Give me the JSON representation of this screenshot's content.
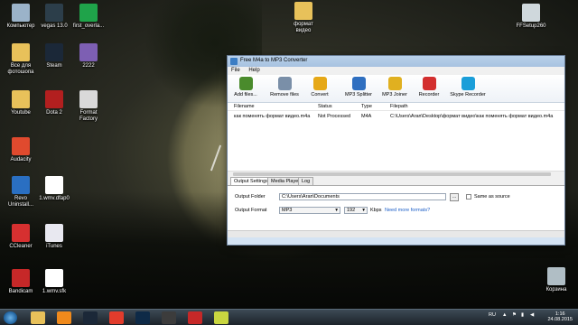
{
  "desktop": {
    "icons": [
      {
        "label": "Компьютер",
        "icon": "computer-icon",
        "color": "#9bb3c9"
      },
      {
        "label": "vegas 13.0",
        "icon": "vegas-icon",
        "color": "#2c3e4a"
      },
      {
        "label": "first_overla...",
        "icon": "green-app-icon",
        "color": "#1fa34a"
      },
      {
        "label": "Все для фотошопа",
        "icon": "folder-icon",
        "color": "#e8c15a"
      },
      {
        "label": "Steam",
        "icon": "steam-icon",
        "color": "#1b2838"
      },
      {
        "label": "2222",
        "icon": "image-file-icon",
        "color": "#7d5fb3"
      },
      {
        "label": "Youtube",
        "icon": "folder-icon",
        "color": "#e8c15a"
      },
      {
        "label": "Dota 2",
        "icon": "dota-icon",
        "color": "#b21f1f"
      },
      {
        "label": "Format Factory",
        "icon": "format-factory-icon",
        "color": "#d9d9d9"
      },
      {
        "label": "Audacity",
        "icon": "audacity-icon",
        "color": "#e04a2e"
      },
      {
        "label": "Revo Uninstall...",
        "icon": "revo-icon",
        "color": "#2a6fc2"
      },
      {
        "label": "1.wmv.dfap0",
        "icon": "file-icon",
        "color": "#ffffff"
      },
      {
        "label": "CCleaner",
        "icon": "ccleaner-icon",
        "color": "#d63030"
      },
      {
        "label": "iTunes",
        "icon": "itunes-icon",
        "color": "#e8e8f0"
      },
      {
        "label": "Bandicam",
        "icon": "bandicam-icon",
        "color": "#c62828"
      },
      {
        "label": "1.wmv.sfk",
        "icon": "file-icon",
        "color": "#ffffff"
      },
      {
        "label": "формат видео",
        "icon": "folder-icon",
        "color": "#e8c15a"
      },
      {
        "label": "FFSetup260",
        "icon": "installer-icon",
        "color": "#cfd8dc"
      },
      {
        "label": "Корзина",
        "icon": "recycle-bin-icon",
        "color": "#b0bec5"
      }
    ]
  },
  "window": {
    "title": "Free M4a to MP3 Converter",
    "menu": [
      "File",
      "Help"
    ],
    "toolbar": [
      {
        "label": "Add files...",
        "icon": "add-files-icon",
        "color": "#4a8b2c"
      },
      {
        "label": "Remove files",
        "icon": "remove-files-icon",
        "color": "#7a8fa8"
      },
      {
        "label": "Convert",
        "icon": "convert-icon",
        "color": "#e6a817"
      },
      {
        "label": "MP3 Splitter",
        "icon": "mp3-splitter-icon",
        "color": "#2f6fc0"
      },
      {
        "label": "MP3 Joiner",
        "icon": "mp3-joiner-icon",
        "color": "#e0b020"
      },
      {
        "label": "Recorder",
        "icon": "recorder-icon",
        "color": "#d32f2f"
      },
      {
        "label": "Skype Recorder",
        "icon": "skype-recorder-icon",
        "color": "#1a9ed9"
      }
    ],
    "columns": [
      "Filename",
      "Status",
      "Type",
      "Filepath"
    ],
    "rows": [
      {
        "filename": "как поменять формат видео.m4a",
        "status": "Not Processed",
        "type": "M4A",
        "filepath": "C:\\Users\\Агап\\Desktop\\формат видео\\как поменять формат видео.m4a"
      }
    ],
    "tabs": [
      "Output Settings",
      "Media Player",
      "Log"
    ],
    "output_folder_label": "Output Folder",
    "output_folder_value": "C:\\Users\\Агап\\Documents",
    "browse_label": "...",
    "same_as_source_label": "Same as source",
    "output_format_label": "Output Format",
    "format_value": "MP3",
    "bitrate_value": "192",
    "bitrate_unit": "Kbps",
    "more_formats_link": "Need more formats?"
  },
  "taskbar": {
    "apps": [
      {
        "icon": "explorer-icon",
        "color": "#e8c15a"
      },
      {
        "icon": "media-player-icon",
        "color": "#f08a1c"
      },
      {
        "icon": "steam-icon",
        "color": "#1b2838"
      },
      {
        "icon": "yandex-browser-icon",
        "color": "#e23c2c"
      },
      {
        "icon": "photoshop-icon",
        "color": "#0e2a47"
      },
      {
        "icon": "video-icon",
        "color": "#3c3c3c"
      },
      {
        "icon": "bandicam-icon",
        "color": "#c62828"
      },
      {
        "icon": "converter-app-icon",
        "color": "#c9d640"
      }
    ],
    "language": "RU",
    "time": "1:16",
    "date": "24.08.2015"
  }
}
